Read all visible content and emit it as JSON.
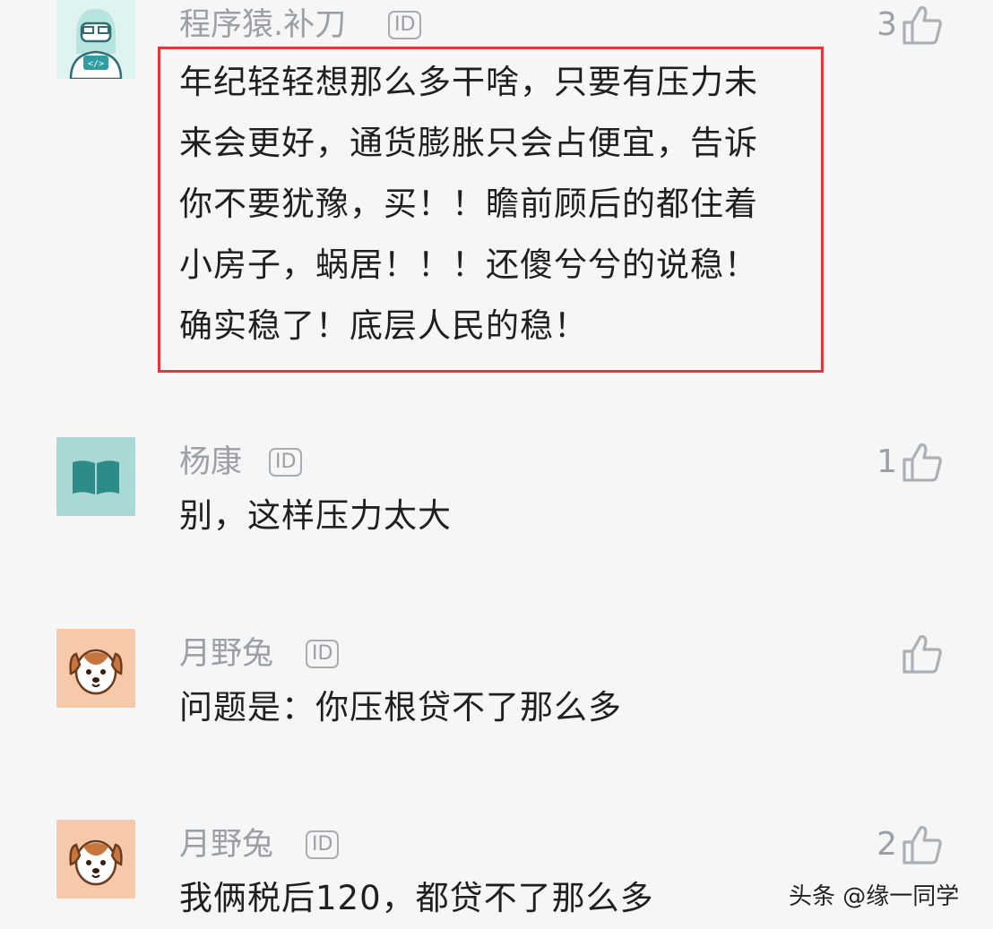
{
  "comments": [
    {
      "username": "程序猿.补刀",
      "badge": "ID",
      "likes": "3",
      "avatar_icon": "coder-avatar-icon",
      "lines": [
        "年纪轻轻想那么多干啥，只要有压力未",
        "来会更好，通货膨胀只会占便宜，告诉",
        "你不要犹豫，买！！瞻前顾后的都住着",
        "小房子，蜗居！！！还傻兮兮的说稳！",
        "确实稳了！底层人民的稳！"
      ],
      "highlighted": true,
      "highlight_color": "#e0393c"
    },
    {
      "username": "杨康",
      "badge": "ID",
      "likes": "1",
      "avatar_icon": "book-avatar-icon",
      "lines": [
        "别，这样压力太大"
      ]
    },
    {
      "username": "月野兔",
      "badge": "ID",
      "likes": "",
      "avatar_icon": "dog-avatar-icon",
      "lines": [
        "问题是：你压根贷不了那么多"
      ]
    },
    {
      "username": "月野兔",
      "badge": "ID",
      "likes": "2",
      "avatar_icon": "dog-avatar-icon",
      "lines": [
        "我俩税后120，都贷不了那么多"
      ]
    }
  ],
  "like_icon": "thumbs-up-icon",
  "watermark": "头条 @缘一同学",
  "colors": {
    "background": "#f6f6f6",
    "meta_gray": "#9aa0a6",
    "text": "#1f1f1f",
    "highlight_border": "#e0393c"
  }
}
